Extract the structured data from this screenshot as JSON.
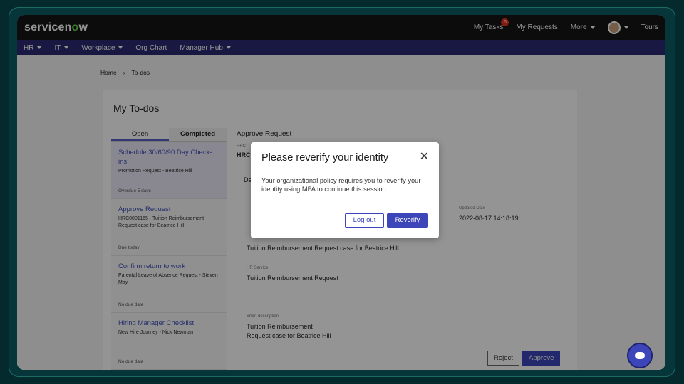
{
  "topbar": {
    "logo_part1": "servicen",
    "logo_o": "o",
    "logo_part2": "w",
    "my_tasks": "My Tasks",
    "tasks_count": "6",
    "my_requests": "My Requests",
    "more": "More",
    "tours": "Tours"
  },
  "subnav": {
    "items": [
      "HR",
      "IT",
      "Workplace",
      "Org Chart",
      "Manager Hub"
    ]
  },
  "breadcrumb": {
    "home": "Home",
    "sep": "›",
    "current": "To-dos"
  },
  "page": {
    "title": "My To-dos",
    "tab_open": "Open",
    "tab_completed": "Completed"
  },
  "todos": [
    {
      "title": "Schedule 30/60/90 Day Check-ins",
      "subtitle": "Promotion Request - Beatrice Hill",
      "due": "Overdue 5 days"
    },
    {
      "title": "Approve Request",
      "subtitle": "HRC0001165 - Tuition Reimbursement Request case for Beatrice Hill",
      "due": "Due today"
    },
    {
      "title": "Confirm return to work",
      "subtitle": "Parental Leave of Absence Request - Steven May",
      "due": "No due date"
    },
    {
      "title": "Hiring Manager Checklist",
      "subtitle": "New Hire Journey - Nick Newman",
      "due": "No due date"
    }
  ],
  "detail": {
    "heading": "Approve Request",
    "hrc_label": "HRC",
    "hrc_value": "HRC",
    "tab_de": "De",
    "updated_label": "Updated Date",
    "updated_value": "2022-08-17 14:18:19",
    "short_desc_value": "Tuition Reimbursement Request case for Beatrice Hill",
    "service_label": "HR Service",
    "service_value": "Tuition Reimbursement Request",
    "short_desc_label": "Short description",
    "desc_line1": "Tuition Reimbursement",
    "desc_line2": "Request case for Beatrice Hill",
    "reject": "Reject",
    "approve": "Approve"
  },
  "modal": {
    "title": "Please reverify your identity",
    "close": "✕",
    "message": "Your organizational policy requires you to reverify your identity using MFA to continue this session.",
    "logout": "Log out",
    "reverify": "Reverify"
  }
}
